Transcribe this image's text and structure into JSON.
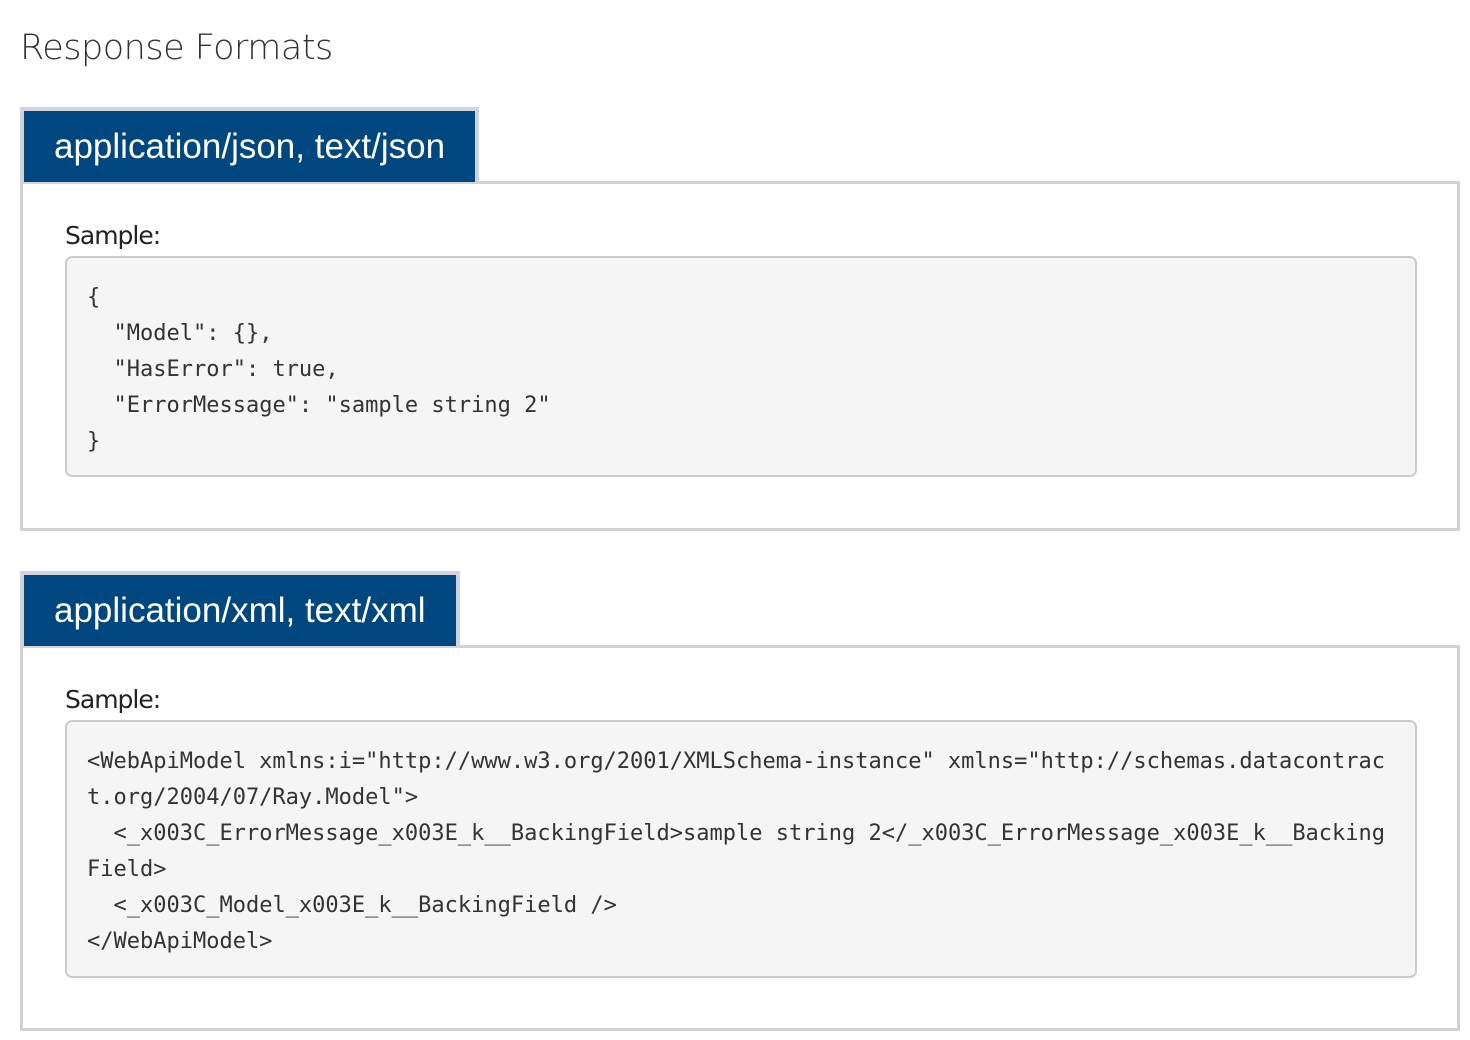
{
  "page": {
    "title": "Response Formats"
  },
  "formats": [
    {
      "label": "application/json, text/json",
      "sample_label": "Sample:",
      "code": "{\n  \"Model\": {},\n  \"HasError\": true,\n  \"ErrorMessage\": \"sample string 2\"\n}"
    },
    {
      "label": "application/xml, text/xml",
      "sample_label": "Sample:",
      "code": "<WebApiModel xmlns:i=\"http://www.w3.org/2001/XMLSchema-instance\" xmlns=\"http://schemas.datacontract.org/2004/07/Ray.Model\">\n  <_x003C_ErrorMessage_x003E_k__BackingField>sample string 2</_x003C_ErrorMessage_x003E_k__BackingField>\n  <_x003C_Model_x003E_k__BackingField />\n</WebApiModel>"
    }
  ],
  "colors": {
    "tab_background": "#00467f",
    "tab_text": "#ffffff",
    "code_background": "#f5f5f5",
    "panel_border": "#d3d3d3"
  }
}
